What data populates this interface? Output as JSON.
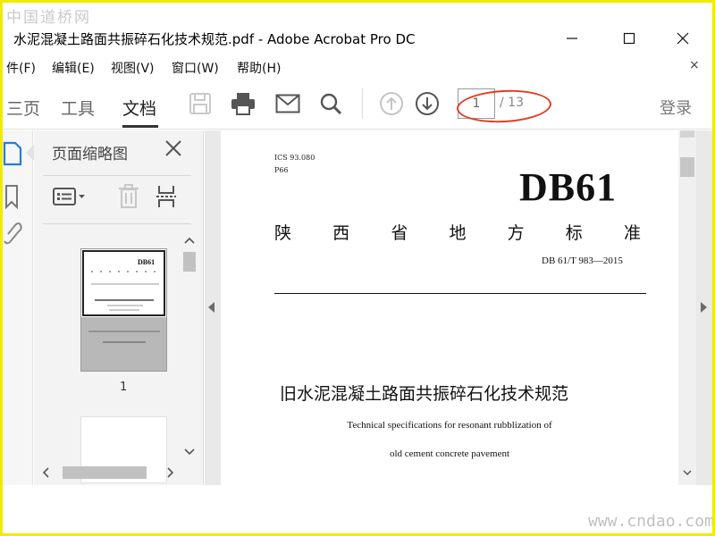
{
  "watermark": {
    "top": "中国道桥网",
    "bottom": "www.cndao.com"
  },
  "window": {
    "title": "水泥混凝土路面共振碎石化技术规范.pdf - Adobe Acrobat Pro DC",
    "minimize_icon": "minimize-icon",
    "maximize_icon": "maximize-icon",
    "close_icon": "close-icon"
  },
  "menu": {
    "items": [
      "件(F)",
      "编辑(E)",
      "视图(V)",
      "窗口(W)",
      "帮助(H)"
    ],
    "close_doc": "×"
  },
  "toolbar": {
    "tabs": [
      "三页",
      "工具",
      "文档"
    ],
    "active_tab": "文档",
    "icons": [
      "save-icon",
      "print-icon",
      "mail-icon",
      "search-icon",
      "page-up-icon",
      "page-down-icon"
    ],
    "page_current": "1",
    "page_total": "/ 13",
    "login": "登录",
    "highlight_color": "#e53b22"
  },
  "thumbnails": {
    "title": "页面缩略图",
    "page_label": "1",
    "tools": [
      "options-icon",
      "delete-icon",
      "extract-icon"
    ]
  },
  "document": {
    "ics": "ICS 93.080",
    "category": "P66",
    "standard_mark": "DB61",
    "province_chars": [
      "陕",
      "西",
      "省",
      "地",
      "方",
      "标",
      "准"
    ],
    "code": "DB 61/T 983—2015",
    "title_cn": "旧水泥混凝土路面共振碎石化技术规范",
    "title_en_line1": "Technical specifications for resonant rubblization of",
    "title_en_line2": "old cement concrete pavement"
  }
}
